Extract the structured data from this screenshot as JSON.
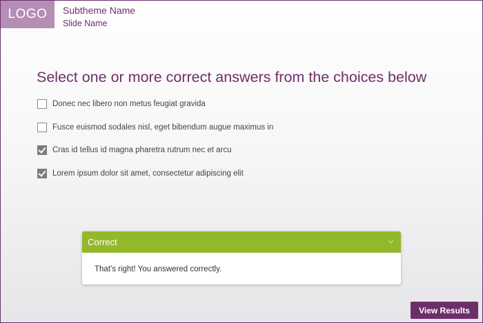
{
  "header": {
    "logo_text": "LOGO",
    "subtheme_name": "Subtheme  Name",
    "slide_name": "Slide Name"
  },
  "question": {
    "prompt": "Select one or more correct answers from the choices below",
    "choices": [
      {
        "label": "Donec nec libero non metus feugiat gravida",
        "checked": false
      },
      {
        "label": "Fusce euismod sodales nisl, eget bibendum augue maximus in",
        "checked": false
      },
      {
        "label": "Cras id tellus id magna pharetra rutrum nec et arcu",
        "checked": true
      },
      {
        "label": "Lorem ipsum dolor sit amet, consectetur adipiscing elit",
        "checked": true
      }
    ]
  },
  "feedback": {
    "title": "Correct",
    "message": "That's right! You answered correctly.",
    "chevron_icon": "chevron-down-icon",
    "color": "#93b92a"
  },
  "footer": {
    "view_results_label": "View Results"
  },
  "colors": {
    "brand": "#6d2f6a",
    "logo_bg": "#b58eb5",
    "correct": "#93b92a"
  }
}
